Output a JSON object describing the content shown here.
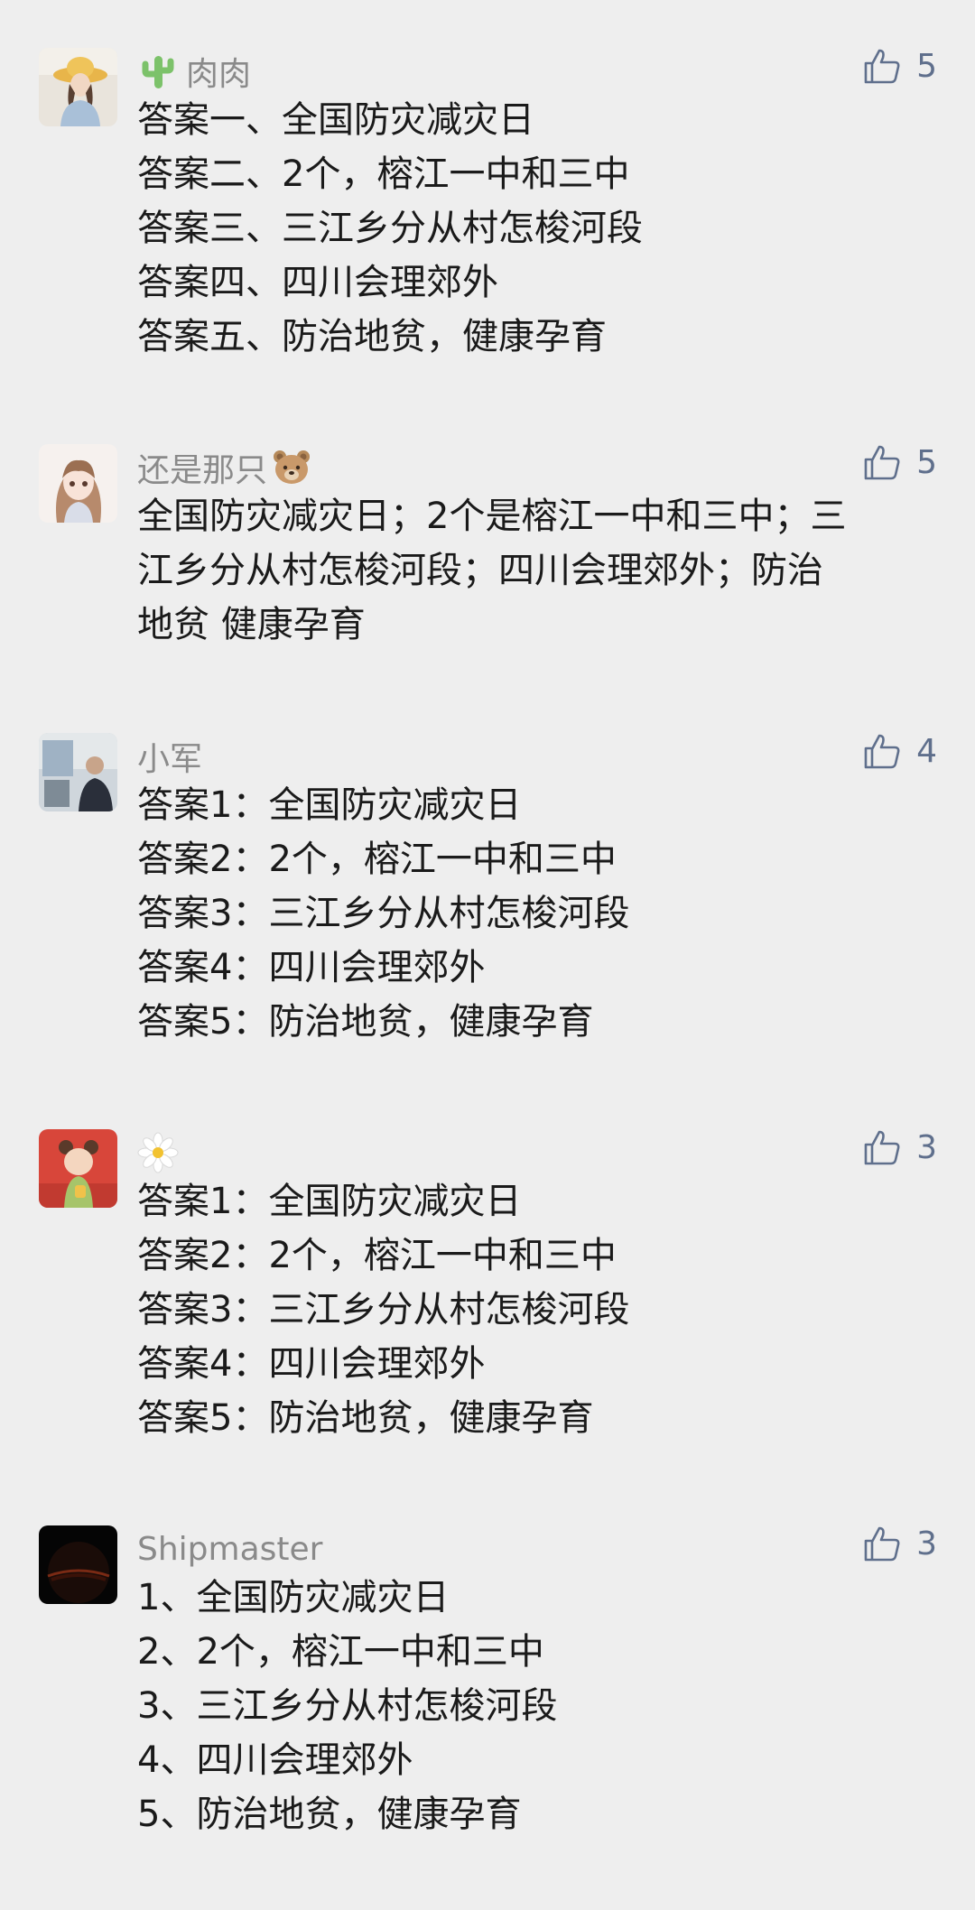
{
  "comments": [
    {
      "name": "肉肉",
      "likes": "5",
      "avatar_icon": "avatar-woman-yellow-hat",
      "name_icon": "cactus-icon",
      "lines": [
        "答案一、全国防灾减灾日",
        "答案二、2个，榕江一中和三中",
        "答案三、三江乡分从村怎梭河段",
        "答案四、四川会理郊外",
        "答案五、防治地贫，健康孕育"
      ]
    },
    {
      "name": "还是那只",
      "likes": "5",
      "avatar_icon": "avatar-anime-girl",
      "name_icon": "bear-face-icon",
      "lines": [
        "全国防灾减灾日；2个是榕江一中和三中；三",
        "江乡分从村怎梭河段；四川会理郊外；防治",
        "地贫 健康孕育"
      ]
    },
    {
      "name": "小军",
      "likes": "4",
      "avatar_icon": "avatar-man-office",
      "lines": [
        "答案1：全国防灾减灾日",
        "答案2：2个，榕江一中和三中",
        "答案3：三江乡分从村怎梭河段",
        "答案4：四川会理郊外",
        "答案5：防治地贫，健康孕育"
      ]
    },
    {
      "name": "",
      "likes": "3",
      "avatar_icon": "avatar-child-red-background",
      "name_icon": "daisy-flower-icon",
      "lines": [
        "答案1：全国防灾减灾日",
        "答案2：2个，榕江一中和三中",
        "答案3：三江乡分从村怎梭河段",
        "答案4：四川会理郊外",
        "答案5：防治地贫，健康孕育"
      ]
    },
    {
      "name": "Shipmaster",
      "likes": "3",
      "avatar_icon": "avatar-dark-eclipse",
      "lines": [
        "1、全国防灾减灾日",
        "2、2个，榕江一中和三中",
        "3、三江乡分从村怎梭河段",
        "4、四川会理郊外",
        "5、防治地贫，健康孕育"
      ]
    }
  ],
  "colors": {
    "background": "#eeeeee",
    "name": "#8a8a8a",
    "content": "#1a1a1a",
    "like": "#5f6f8c"
  }
}
